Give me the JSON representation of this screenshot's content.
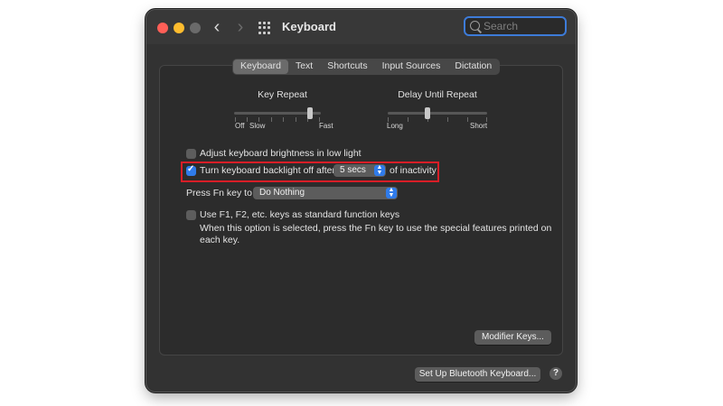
{
  "window": {
    "title": "Keyboard",
    "search": {
      "placeholder": "Search",
      "value": ""
    },
    "traffic_lights": {
      "close": "#ff5f57",
      "minimize": "#febc2e",
      "maximize": "#6a6a6a"
    }
  },
  "tabs": [
    {
      "label": "Keyboard",
      "active": true
    },
    {
      "label": "Text",
      "active": false
    },
    {
      "label": "Shortcuts",
      "active": false
    },
    {
      "label": "Input Sources",
      "active": false
    },
    {
      "label": "Dictation",
      "active": false
    }
  ],
  "key_repeat": {
    "label": "Key Repeat",
    "min_label": "Off",
    "slow_label": "Slow",
    "max_label": "Fast",
    "level": 0.88
  },
  "delay_until_repeat": {
    "label": "Delay Until Repeat",
    "min_label": "Long",
    "max_label": "Short",
    "level": 0.4
  },
  "options": {
    "adjust_brightness": {
      "label": "Adjust keyboard brightness in low light",
      "checked": false
    },
    "backlight_off": {
      "label_before": "Turn keyboard backlight off after",
      "popup_value": "5 secs",
      "label_after": "of inactivity",
      "checked": true
    },
    "fn_key": {
      "label": "Press Fn key to",
      "popup_value": "Do Nothing"
    },
    "function_keys": {
      "label": "Use F1, F2, etc. keys as standard function keys",
      "description_line1": "When this option is selected, press the Fn key to use the special features printed on",
      "description_line2": "each key.",
      "checked": false
    }
  },
  "buttons": {
    "modifier_keys": "Modifier Keys...",
    "bluetooth": "Set Up Bluetooth Keyboard...",
    "help": "?"
  },
  "colors": {
    "accent": "#2f7bea",
    "highlight": "#d81e27"
  }
}
